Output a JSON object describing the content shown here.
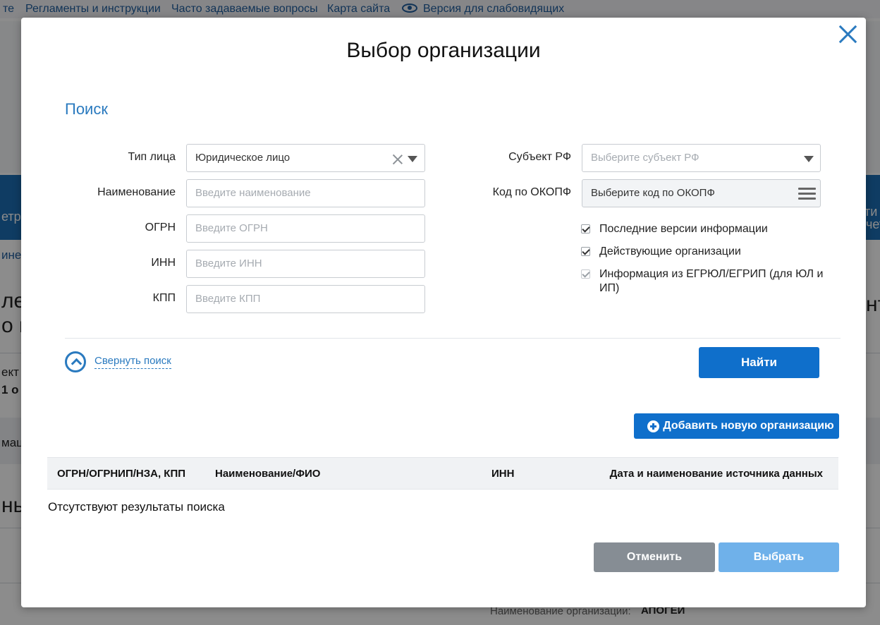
{
  "background": {
    "nav": [
      "те",
      "Регламенты и инструкции",
      "Часто задаваемые вопросы",
      "Карта сайта",
      "Версия для слабовидящих"
    ],
    "fragments": [
      "етри",
      "ине",
      "лен",
      "о и",
      "ект",
      "1 о",
      "мац",
      "нь",
      "Наименование организации:",
      "АПОГЕИ",
      "ти",
      "чет",
      "нт"
    ]
  },
  "modal": {
    "title": "Выбор организации",
    "close_label": "×",
    "section_title": "Поиск",
    "left_fields": [
      {
        "label": "Тип лица",
        "value": "Юридическое лицо"
      },
      {
        "label": "Наименование",
        "placeholder": "Введите наименование"
      },
      {
        "label": "ОГРН",
        "placeholder": "Введите ОГРН"
      },
      {
        "label": "ИНН",
        "placeholder": "Введите ИНН"
      },
      {
        "label": "КПП",
        "placeholder": "Введите КПП"
      }
    ],
    "right_fields": [
      {
        "label": "Субъект РФ",
        "placeholder": "Выберите субъект РФ"
      },
      {
        "label": "Код по ОКОПФ",
        "placeholder": "Выберите код по ОКОПФ"
      }
    ],
    "checkboxes": [
      {
        "label": "Последние версии информации",
        "checked": true,
        "disabled": false
      },
      {
        "label": "Действующие организации",
        "checked": true,
        "disabled": false
      },
      {
        "label": "Информация из ЕГРЮЛ/ЕГРИП (для ЮЛ и ИП)",
        "checked": true,
        "disabled": true
      }
    ],
    "collapse_label": "Свернуть поиск",
    "find_label": "Найти",
    "add_label": "Добавить новую организацию",
    "table_headers": [
      "ОГРН/ОГРНИП/НЗА, КПП",
      "Наименование/ФИО",
      "ИНН",
      "Дата и наименование источника данных"
    ],
    "empty_message": "Отсутствуют результаты поиска",
    "cancel_label": "Отменить",
    "select_label": "Выбрать"
  }
}
